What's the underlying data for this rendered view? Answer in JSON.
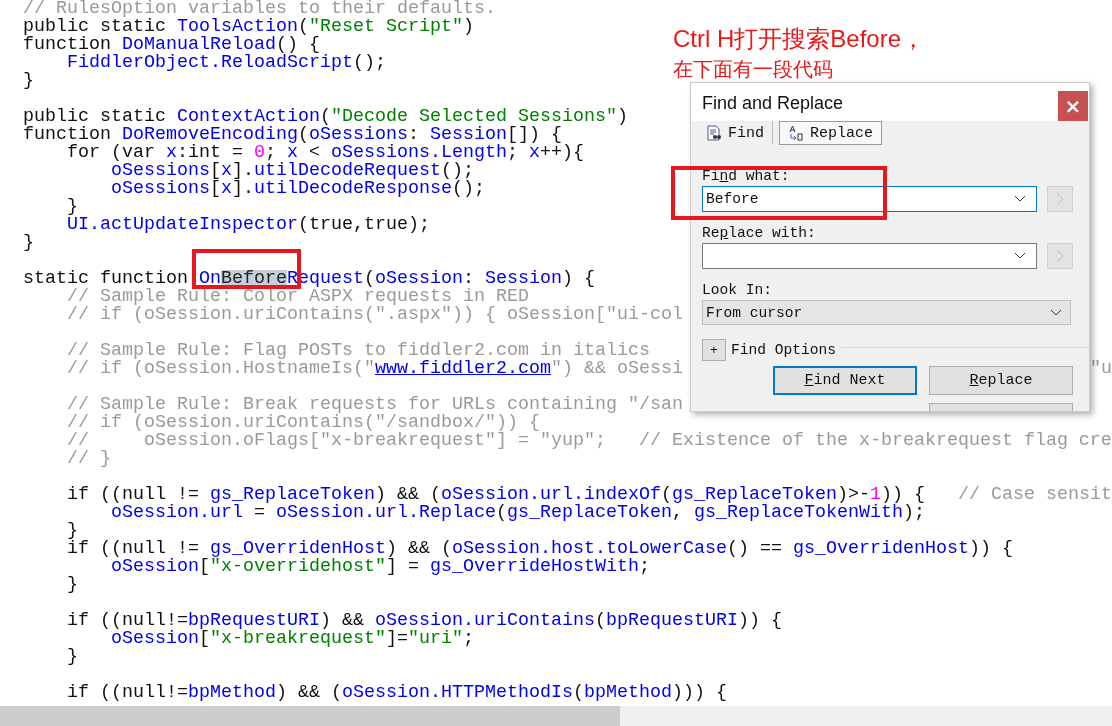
{
  "editor": {
    "lines": [
      {
        "segs": [
          {
            "kind": "comment",
            "t": "// RulesOption variables to their defaults."
          }
        ]
      },
      {
        "segs": [
          {
            "kind": "plain",
            "t": "public static "
          },
          {
            "kind": "ident",
            "t": "ToolsAction"
          },
          {
            "kind": "plain",
            "t": "("
          },
          {
            "kind": "string",
            "t": "\"Reset Script\""
          },
          {
            "kind": "plain",
            "t": ")"
          }
        ]
      },
      {
        "segs": [
          {
            "kind": "plain",
            "t": "function "
          },
          {
            "kind": "ident",
            "t": "DoManualReload"
          },
          {
            "kind": "plain",
            "t": "() {"
          }
        ]
      },
      {
        "segs": [
          {
            "kind": "ident",
            "t": "    FiddlerObject.ReloadScript"
          },
          {
            "kind": "plain",
            "t": "();"
          }
        ]
      },
      {
        "segs": [
          {
            "kind": "plain",
            "t": "}"
          }
        ]
      },
      {
        "kind": "blank"
      },
      {
        "segs": [
          {
            "kind": "plain",
            "t": "public static "
          },
          {
            "kind": "ident",
            "t": "ContextAction"
          },
          {
            "kind": "plain",
            "t": "("
          },
          {
            "kind": "string",
            "t": "\"Decode Selected Sessions\""
          },
          {
            "kind": "plain",
            "t": ")"
          }
        ]
      },
      {
        "segs": [
          {
            "kind": "plain",
            "t": "function "
          },
          {
            "kind": "ident",
            "t": "DoRemoveEncoding"
          },
          {
            "kind": "plain",
            "t": "("
          },
          {
            "kind": "ident",
            "t": "oSessions"
          },
          {
            "kind": "plain",
            "t": ": "
          },
          {
            "kind": "ident",
            "t": "Session"
          },
          {
            "kind": "plain",
            "t": "[]) {"
          }
        ]
      },
      {
        "segs": [
          {
            "kind": "plain",
            "t": "    for (var "
          },
          {
            "kind": "ident",
            "t": "x"
          },
          {
            "kind": "plain",
            "t": ":int = "
          },
          {
            "kind": "number",
            "t": "0"
          },
          {
            "kind": "plain",
            "t": "; "
          },
          {
            "kind": "ident",
            "t": "x"
          },
          {
            "kind": "plain",
            "t": " < "
          },
          {
            "kind": "ident",
            "t": "oSessions.Length"
          },
          {
            "kind": "plain",
            "t": "; "
          },
          {
            "kind": "ident",
            "t": "x"
          },
          {
            "kind": "plain",
            "t": "++){"
          }
        ]
      },
      {
        "segs": [
          {
            "kind": "ident",
            "t": "        oSessions"
          },
          {
            "kind": "plain",
            "t": "["
          },
          {
            "kind": "ident",
            "t": "x"
          },
          {
            "kind": "plain",
            "t": "]."
          },
          {
            "kind": "ident",
            "t": "utilDecodeRequest"
          },
          {
            "kind": "plain",
            "t": "();"
          }
        ]
      },
      {
        "segs": [
          {
            "kind": "ident",
            "t": "        oSessions"
          },
          {
            "kind": "plain",
            "t": "["
          },
          {
            "kind": "ident",
            "t": "x"
          },
          {
            "kind": "plain",
            "t": "]."
          },
          {
            "kind": "ident",
            "t": "utilDecodeResponse"
          },
          {
            "kind": "plain",
            "t": "();"
          }
        ]
      },
      {
        "segs": [
          {
            "kind": "plain",
            "t": "    }"
          }
        ]
      },
      {
        "segs": [
          {
            "kind": "ident",
            "t": "    UI.actUpdateInspector"
          },
          {
            "kind": "plain",
            "t": "(true,true);"
          }
        ]
      },
      {
        "segs": [
          {
            "kind": "plain",
            "t": "}"
          }
        ]
      },
      {
        "kind": "blank"
      },
      {
        "segs": [
          {
            "kind": "plain",
            "t": "static function "
          },
          {
            "kind": "ident",
            "t": "On"
          },
          {
            "kind": "selection",
            "t": "Before"
          },
          {
            "kind": "ident",
            "t": "Request"
          },
          {
            "kind": "plain",
            "t": "("
          },
          {
            "kind": "ident",
            "t": "oSession"
          },
          {
            "kind": "plain",
            "t": ": "
          },
          {
            "kind": "ident",
            "t": "Session"
          },
          {
            "kind": "plain",
            "t": ") {"
          }
        ]
      },
      {
        "segs": [
          {
            "kind": "comment",
            "t": "    // Sample Rule: Color ASPX requests in RED"
          }
        ]
      },
      {
        "segs": [
          {
            "kind": "comment",
            "t": "    // if (oSession.uriContains(\".aspx\")) { oSession[\"ui-col"
          }
        ]
      },
      {
        "kind": "blank"
      },
      {
        "segs": [
          {
            "kind": "comment",
            "t": "    // Sample Rule: Flag POSTs to fiddler2.com in italics"
          }
        ]
      },
      {
        "segs": [
          {
            "kind": "comment",
            "t": "    // if (oSession.HostnameIs(\""
          },
          {
            "kind": "link",
            "t": "www.fiddler2.com"
          },
          {
            "kind": "comment",
            "t": "\") && oSessi"
          },
          {
            "kind": "fragment",
            "t": "\"u"
          }
        ]
      },
      {
        "kind": "blank"
      },
      {
        "segs": [
          {
            "kind": "comment",
            "t": "    // Sample Rule: Break requests for URLs containing \"/san"
          }
        ]
      },
      {
        "segs": [
          {
            "kind": "comment",
            "t": "    // if (oSession.uriContains(\"/sandbox/\")) {"
          }
        ]
      },
      {
        "segs": [
          {
            "kind": "comment",
            "t": "    //     oSession.oFlags[\"x-breakrequest\"] = \"yup\";   // Existence of the x-breakrequest flag cre"
          }
        ]
      },
      {
        "segs": [
          {
            "kind": "comment",
            "t": "    // }"
          }
        ]
      },
      {
        "kind": "blank"
      },
      {
        "segs": [
          {
            "kind": "plain",
            "t": "    if ((null != "
          },
          {
            "kind": "ident",
            "t": "gs_ReplaceToken"
          },
          {
            "kind": "plain",
            "t": ") && ("
          },
          {
            "kind": "ident",
            "t": "oSession.url.indexOf"
          },
          {
            "kind": "plain",
            "t": "("
          },
          {
            "kind": "ident",
            "t": "gs_ReplaceToken"
          },
          {
            "kind": "plain",
            "t": ")>-"
          },
          {
            "kind": "number",
            "t": "1"
          },
          {
            "kind": "plain",
            "t": ")) {   "
          },
          {
            "kind": "comment",
            "t": "// Case sensit"
          }
        ]
      },
      {
        "segs": [
          {
            "kind": "ident",
            "t": "        oSession.url"
          },
          {
            "kind": "plain",
            "t": " = "
          },
          {
            "kind": "ident",
            "t": "oSession.url.Replace"
          },
          {
            "kind": "plain",
            "t": "("
          },
          {
            "kind": "ident",
            "t": "gs_ReplaceToken"
          },
          {
            "kind": "plain",
            "t": ", "
          },
          {
            "kind": "ident",
            "t": "gs_ReplaceTokenWith"
          },
          {
            "kind": "plain",
            "t": ");"
          }
        ]
      },
      {
        "segs": [
          {
            "kind": "plain",
            "t": "    }"
          }
        ]
      },
      {
        "segs": [
          {
            "kind": "plain",
            "t": "    if ((null != "
          },
          {
            "kind": "ident",
            "t": "gs_OverridenHost"
          },
          {
            "kind": "plain",
            "t": ") && ("
          },
          {
            "kind": "ident",
            "t": "oSession.host.toLowerCase"
          },
          {
            "kind": "plain",
            "t": "() == "
          },
          {
            "kind": "ident",
            "t": "gs_OverridenHost"
          },
          {
            "kind": "plain",
            "t": ")) {"
          }
        ]
      },
      {
        "segs": [
          {
            "kind": "ident",
            "t": "        oSession"
          },
          {
            "kind": "plain",
            "t": "["
          },
          {
            "kind": "string",
            "t": "\"x-overridehost\""
          },
          {
            "kind": "plain",
            "t": "] = "
          },
          {
            "kind": "ident",
            "t": "gs_OverrideHostWith"
          },
          {
            "kind": "plain",
            "t": ";"
          }
        ]
      },
      {
        "segs": [
          {
            "kind": "plain",
            "t": "    }"
          }
        ]
      },
      {
        "kind": "blank"
      },
      {
        "segs": [
          {
            "kind": "plain",
            "t": "    if ((null!="
          },
          {
            "kind": "ident",
            "t": "bpRequestURI"
          },
          {
            "kind": "plain",
            "t": ") && "
          },
          {
            "kind": "ident",
            "t": "oSession.uriContains"
          },
          {
            "kind": "plain",
            "t": "("
          },
          {
            "kind": "ident",
            "t": "bpRequestURI"
          },
          {
            "kind": "plain",
            "t": ")) {"
          }
        ]
      },
      {
        "segs": [
          {
            "kind": "ident",
            "t": "        oSession"
          },
          {
            "kind": "plain",
            "t": "["
          },
          {
            "kind": "string",
            "t": "\"x-breakrequest\""
          },
          {
            "kind": "plain",
            "t": "]="
          },
          {
            "kind": "string",
            "t": "\"uri\""
          },
          {
            "kind": "plain",
            "t": ";"
          }
        ]
      },
      {
        "segs": [
          {
            "kind": "plain",
            "t": "    }"
          }
        ]
      },
      {
        "kind": "blank"
      },
      {
        "segs": [
          {
            "kind": "plain",
            "t": "    if ((null!="
          },
          {
            "kind": "ident",
            "t": "bpMethod"
          },
          {
            "kind": "plain",
            "t": ") && ("
          },
          {
            "kind": "ident",
            "t": "oSession.HTTPMethodIs"
          },
          {
            "kind": "plain",
            "t": "("
          },
          {
            "kind": "ident",
            "t": "bpMethod"
          },
          {
            "kind": "plain",
            "t": "))) {"
          }
        ]
      }
    ]
  },
  "annotation": {
    "lines": [
      "Ctrl H打开搜索Before，",
      "在下面有一段代码"
    ]
  },
  "dialog": {
    "title": "Find and Replace",
    "close": "×",
    "tabs": [
      {
        "label": "Find",
        "kind": "find",
        "selected": false
      },
      {
        "label": "Replace",
        "kind": "replace",
        "selected": true
      }
    ],
    "find_what": {
      "label": {
        "before": "Fi",
        "key": "n",
        "after": "d what:"
      },
      "value": "Before",
      "focused": true
    },
    "replace_with": {
      "label": {
        "before": "Re",
        "key": "p",
        "after": "lace with:"
      },
      "focused": false
    },
    "look_in": {
      "label": "Look In:",
      "value": "From cursor"
    },
    "find_options": {
      "toggle": "+",
      "label": "Find Options"
    },
    "buttons": [
      {
        "label": {
          "key": "F",
          "after": "ind Next"
        },
        "default": true
      },
      {
        "label": {
          "key": "R",
          "after": "eplace"
        },
        "default": false
      },
      {
        "default": false
      }
    ]
  }
}
